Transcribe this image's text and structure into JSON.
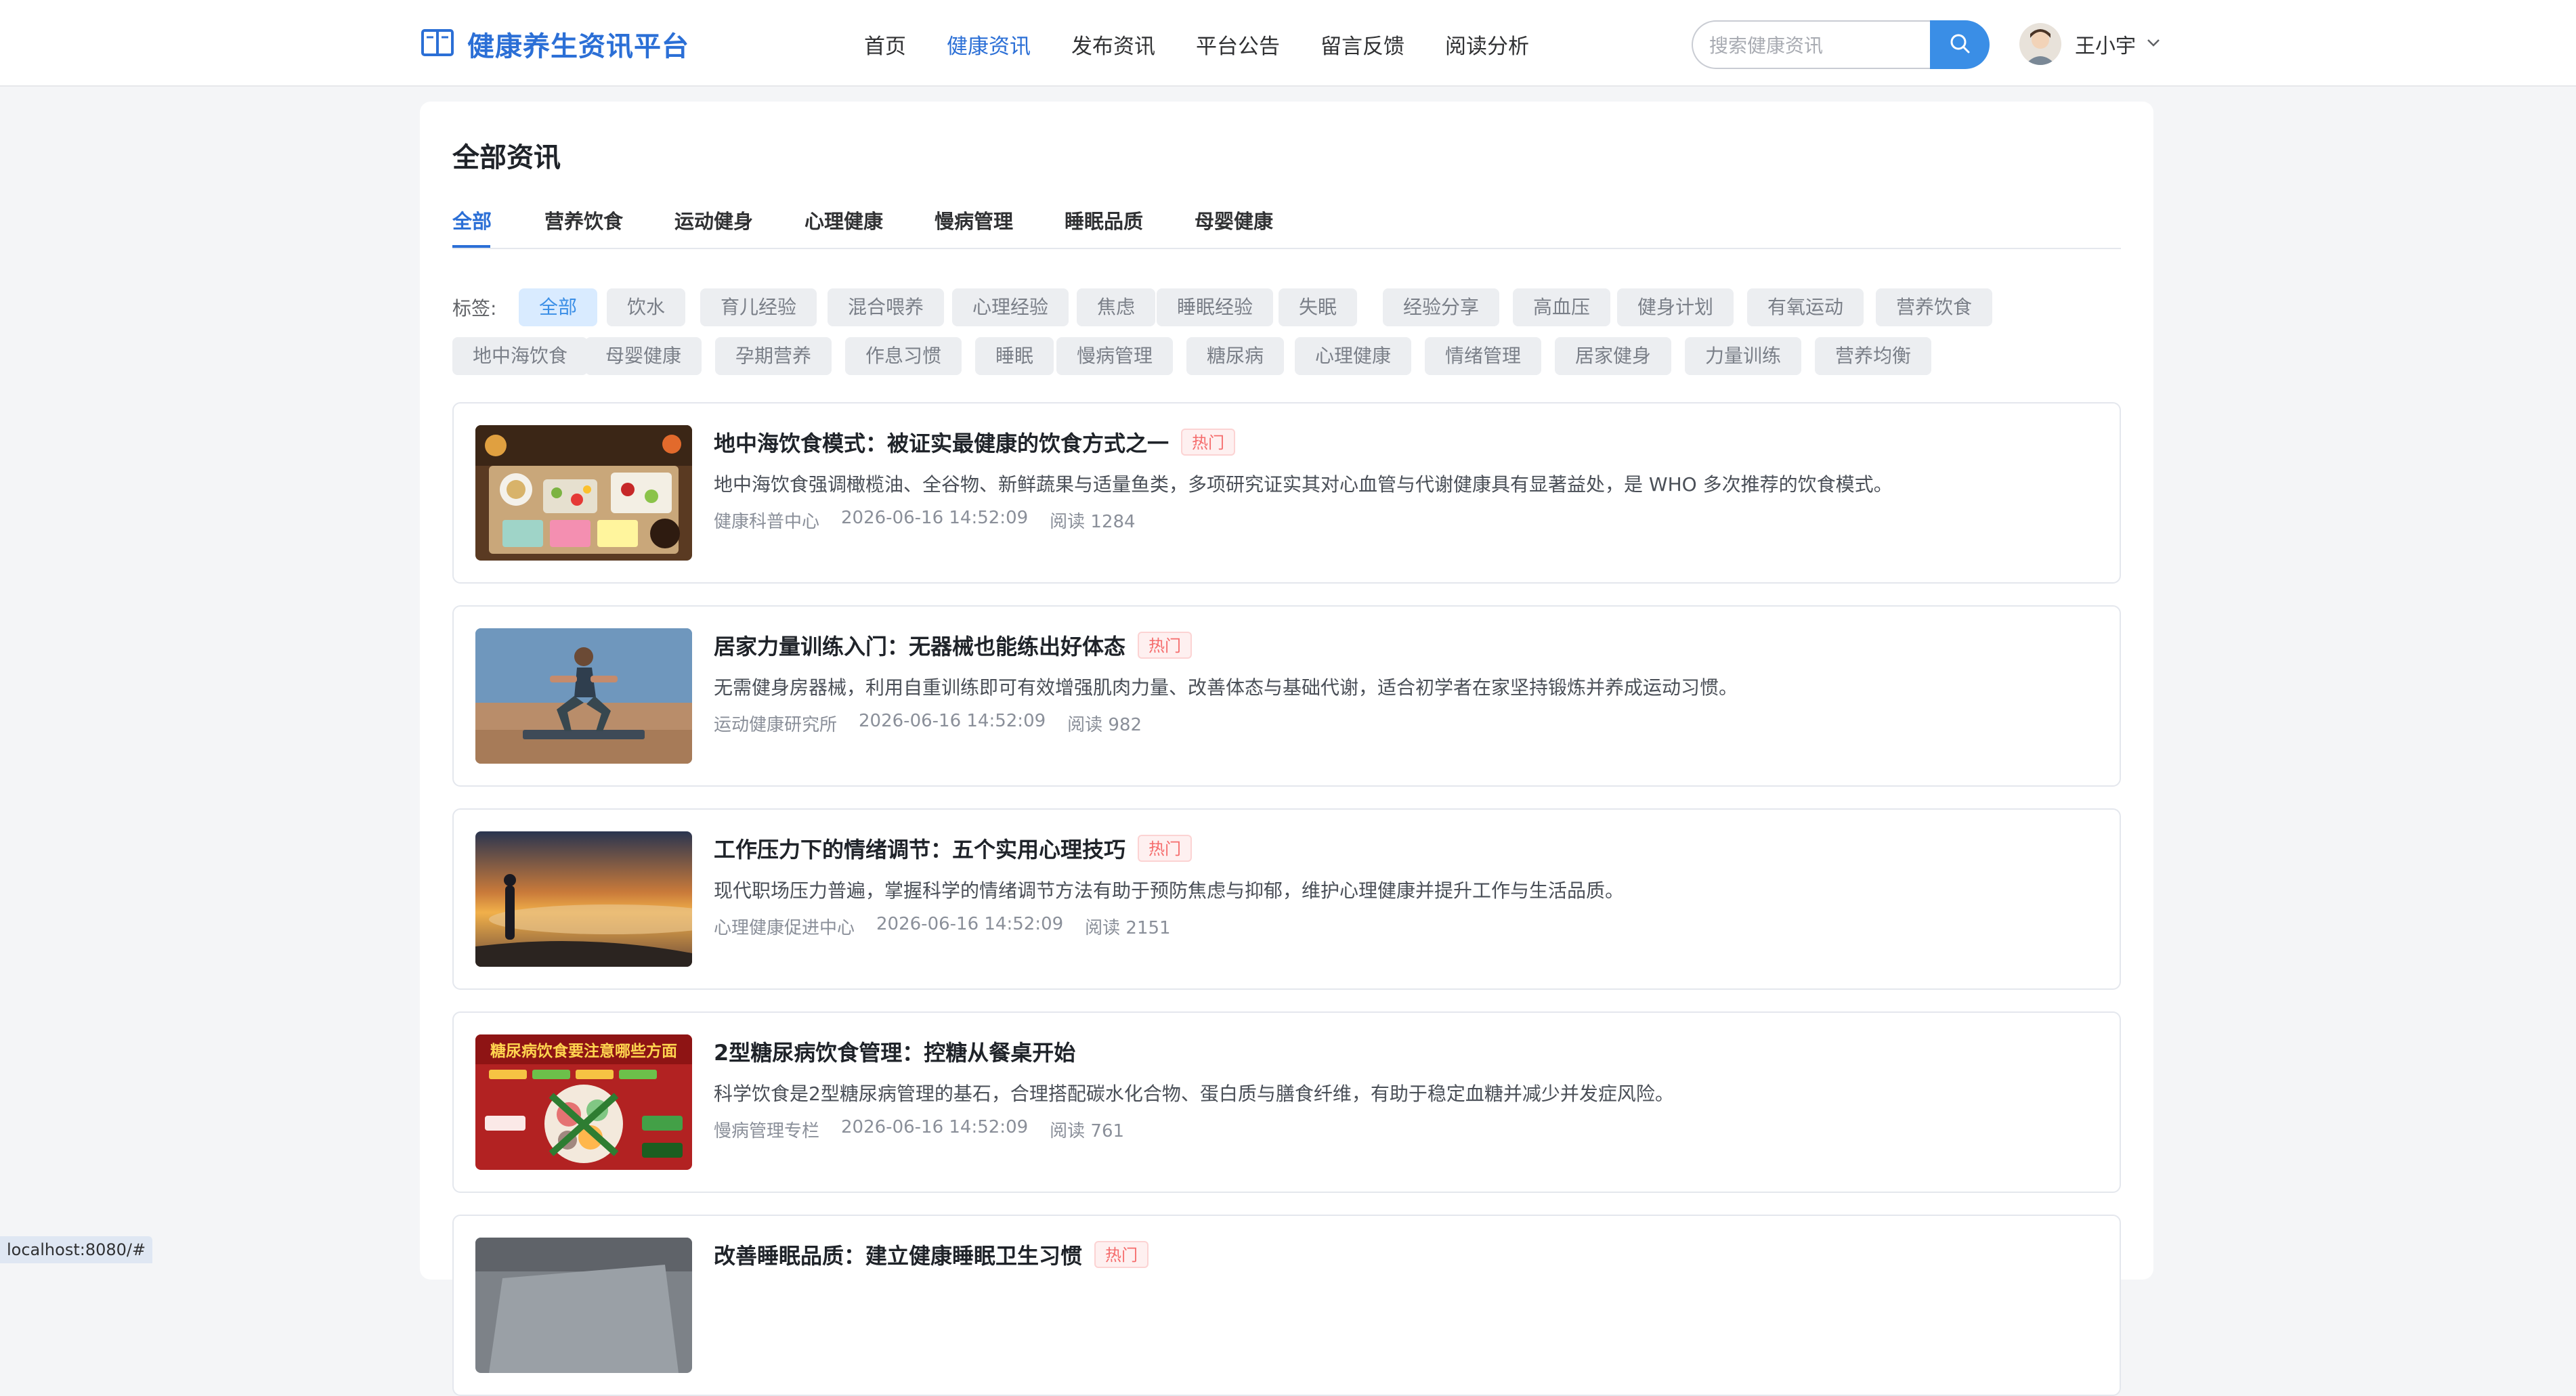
{
  "header": {
    "logo_text": "健康养生资讯平台",
    "nav": [
      "首页",
      "健康资讯",
      "发布资讯",
      "平台公告",
      "留言反馈",
      "阅读分析"
    ],
    "active_nav": "健康资讯",
    "search_placeholder": "搜索健康资讯",
    "user_name": "王小宇"
  },
  "main": {
    "title": "全部资讯",
    "tabs": [
      "全部",
      "营养饮食",
      "运动健身",
      "心理健康",
      "慢病管理",
      "睡眠品质",
      "母婴健康"
    ],
    "active_tab": "全部",
    "tags_label": "标签:",
    "tags": [
      "全部",
      "饮水",
      "育儿经验",
      "混合喂养",
      "心理经验",
      "焦虑",
      "睡眠经验",
      "失眠",
      "经验分享",
      "高血压",
      "健身计划",
      "有氧运动",
      "营养饮食",
      "地中海饮食",
      "母婴健康",
      "孕期营养",
      "作息习惯",
      "睡眠",
      "慢病管理",
      "糖尿病",
      "心理健康",
      "情绪管理",
      "居家健身",
      "力量训练",
      "营养均衡"
    ],
    "active_tag": "全部",
    "hot_label": "热门",
    "articles": [
      {
        "title": "地中海饮食模式：被证实最健康的饮食方式之一",
        "hot": true,
        "summary": "地中海饮食强调橄榄油、全谷物、新鲜蔬果与适量鱼类，多项研究证实其对心血管与代谢健康具有显著益处，是 WHO 多次推荐的饮食模式。",
        "source": "健康科普中心",
        "time": "2026-06-16 14:52:09",
        "reads": "阅读 1284",
        "thumb_icon": "food-photo"
      },
      {
        "title": "居家力量训练入门：无器械也能练出好体态",
        "hot": true,
        "summary": "无需健身房器械，利用自重训练即可有效增强肌肉力量、改善体态与基础代谢，适合初学者在家坚持锻炼并养成运动习惯。",
        "source": "运动健康研究所",
        "time": "2026-06-16 14:52:09",
        "reads": "阅读 982",
        "thumb_icon": "squat-photo"
      },
      {
        "title": "工作压力下的情绪调节：五个实用心理技巧",
        "hot": true,
        "summary": "现代职场压力普遍，掌握科学的情绪调节方法有助于预防焦虑与抑郁，维护心理健康并提升工作与生活品质。",
        "source": "心理健康促进中心",
        "time": "2026-06-16 14:52:09",
        "reads": "阅读 2151",
        "thumb_icon": "sunset-photo"
      },
      {
        "title": "2型糖尿病饮食管理：控糖从餐桌开始",
        "hot": false,
        "summary": "科学饮食是2型糖尿病管理的基石，合理搭配碳水化合物、蛋白质与膳食纤维，有助于稳定血糖并减少并发症风险。",
        "source": "慢病管理专栏",
        "time": "2026-06-16 14:52:09",
        "reads": "阅读 761",
        "thumb_icon": "diabetes-poster",
        "thumb_text": "糖尿病饮食要注意哪些方面"
      },
      {
        "title": "改善睡眠品质：建立健康睡眠卫生习惯",
        "hot": true,
        "summary": "",
        "source": "",
        "time": "",
        "reads": "",
        "thumb_icon": "sleep-photo"
      }
    ]
  },
  "status_url": "localhost:8080/#",
  "colors": {
    "accent": "#2b6fd6",
    "search_button": "#3a8ee6",
    "hot": "#f56c6c",
    "active_tag_bg": "#d9ebff"
  }
}
